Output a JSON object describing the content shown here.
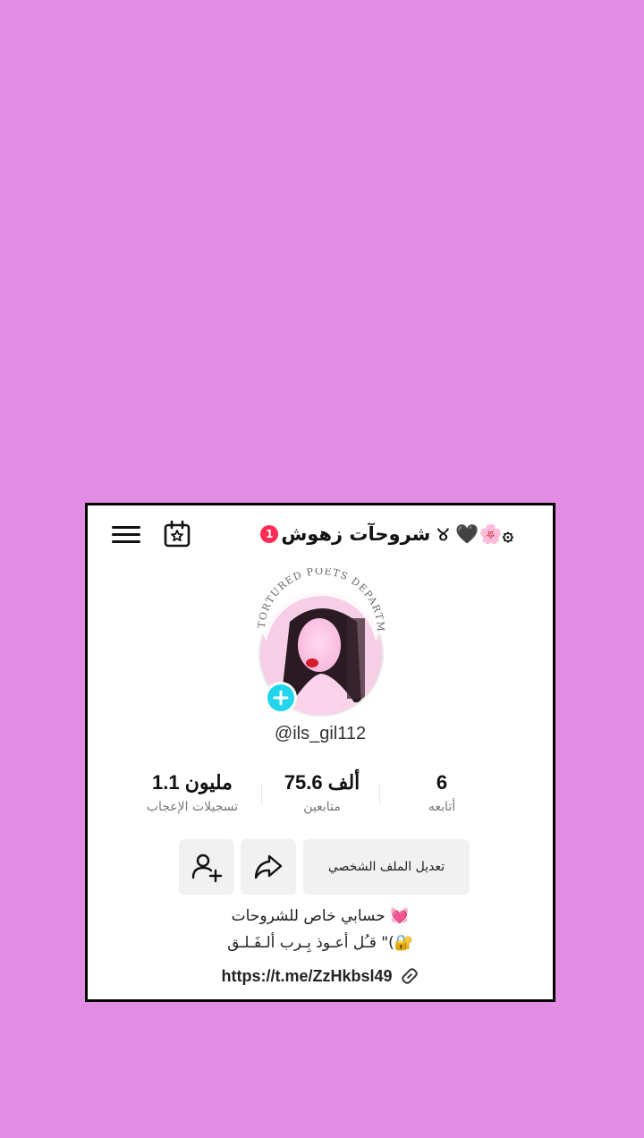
{
  "header": {
    "notification_count": "1",
    "display_name": "شروحآت زهوش ୪ 🖤🌸۞",
    "menu_icon": "hamburger-menu-icon",
    "calendar_icon": "calendar-star-icon"
  },
  "profile": {
    "avatar_caption": "THE TORTURED POETS DEPARTMENT",
    "handle": "@ils_gil112"
  },
  "stats": [
    {
      "value": "6",
      "label": "أتابعه"
    },
    {
      "value": "75.6 ألف",
      "label": "متابعين"
    },
    {
      "value": "1.1 مليون",
      "label": "تسجيلات الإعجاب"
    }
  ],
  "actions": {
    "edit_profile": "تعديل الملف الشخصي",
    "share_icon": "share-arrow-icon",
    "add_friend_icon": "add-user-icon"
  },
  "bio": {
    "line1": "حسابي خاص للشروحات 💓",
    "line2": "قـُل أعـوذ بِـرب ألـفَـلـق \"(🔐"
  },
  "link": {
    "url": "https://t.me/ZzHkbsl49"
  },
  "colors": {
    "background": "#e28de3",
    "card": "#ffffff",
    "accent_plus": "#20d5ec",
    "badge": "#ff2d55"
  }
}
